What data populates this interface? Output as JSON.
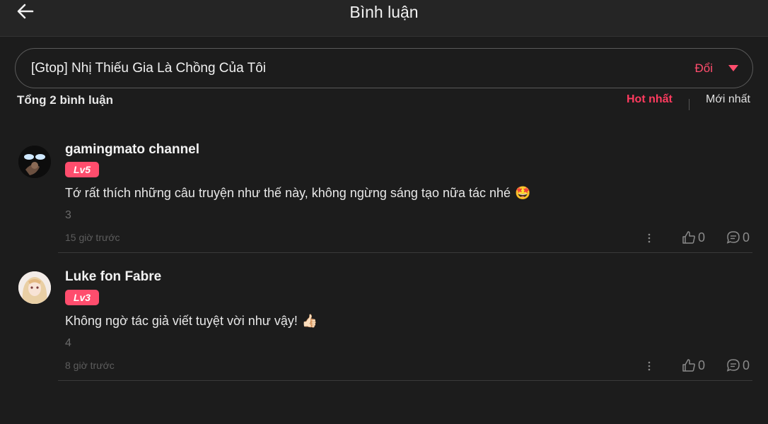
{
  "header": {
    "title": "Bình luận",
    "back_icon": "arrow-left-icon"
  },
  "story_select": {
    "title": "[Gtop] Nhị Thiếu Gia Là Chồng Của Tôi",
    "change_label": "Đổi",
    "arrow_icon": "caret-down-icon"
  },
  "summary": {
    "total_label": "Tổng 2 bình luận",
    "sort_hot": "Hot nhất",
    "sort_new": "Mới nhất"
  },
  "comments": [
    {
      "username": "gamingmato channel",
      "level": "Lv5",
      "text": "Tớ rất thích những câu truyện như thế này, không ngừng sáng tạo nữa tác nhé",
      "emoji": "🤩",
      "extra": "3",
      "time": "15 giờ trước",
      "likes": "0",
      "replies": "0"
    },
    {
      "username": "Luke fon Fabre",
      "level": "Lv3",
      "text": "Không ngờ tác giả viết tuyệt vời như vậy!",
      "emoji": "👍🏻",
      "extra": "4",
      "time": "8 giờ trước",
      "likes": "0",
      "replies": "0"
    }
  ],
  "colors": {
    "accent": "#ff4d6d",
    "background": "#1c1c1c",
    "topbar": "#252525"
  }
}
